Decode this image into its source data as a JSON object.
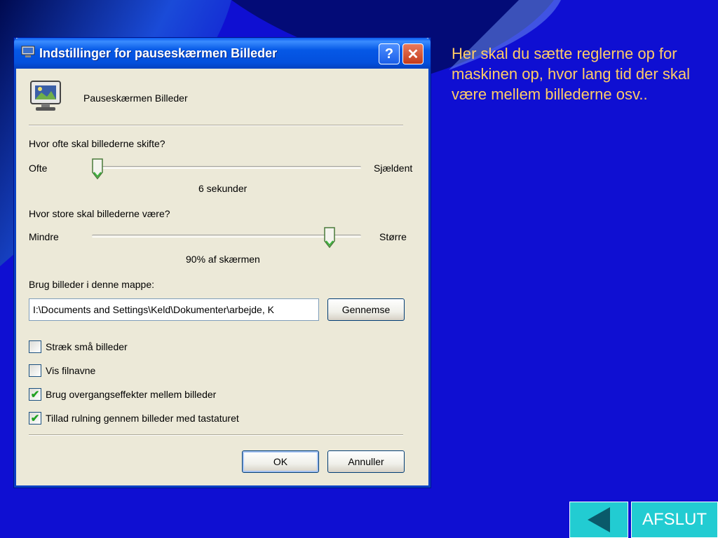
{
  "dialog": {
    "title": "Indstillinger for pauseskærmen Billeder",
    "help_label": "?",
    "close_label": "✕",
    "screensaver_name": "Pauseskærmen Billeder",
    "change_question": "Hvor ofte skal billederne skifte?",
    "change_min": "Ofte",
    "change_max": "Sjældent",
    "change_value_text": "6 sekunder",
    "change_level": 0.0,
    "size_question": "Hvor store skal billederne være?",
    "size_min": "Mindre",
    "size_max": "Større",
    "size_value_text": "90% af skærmen",
    "size_level": 0.9,
    "folder_label": "Brug billeder i denne mappe:",
    "folder_path": "I:\\Documents and Settings\\Keld\\Dokumenter\\arbejde, K",
    "browse_label": "Gennemse",
    "options": [
      {
        "label": "Stræk små billeder",
        "checked": false
      },
      {
        "label": "Vis filnavne",
        "checked": false
      },
      {
        "label": "Brug overgangseffekter mellem billeder",
        "checked": true
      },
      {
        "label": "Tillad rulning gennem billeder med tastaturet",
        "checked": true
      }
    ],
    "ok_label": "OK",
    "cancel_label": "Annuller"
  },
  "side_text": "Her skal du sætte reglerne op for maskinen op, hvor lang tid der skal være mellem billederne osv..",
  "nav": {
    "back_icon": "left-triangle-icon",
    "exit_label": "AFSLUT"
  },
  "colors": {
    "background": "#0f0fd2",
    "side_text": "#ffcc66",
    "nav_button": "#22ccd2"
  }
}
